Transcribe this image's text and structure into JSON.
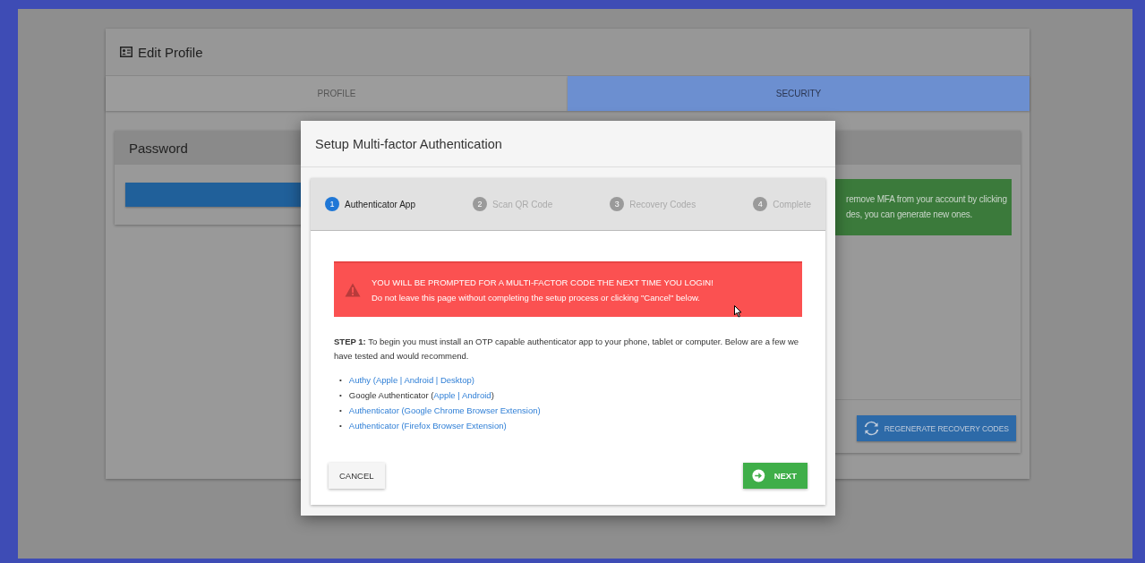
{
  "page": {
    "title": "Edit Profile",
    "tabs": [
      {
        "label": "PROFILE",
        "selected": false
      },
      {
        "label": "SECURITY",
        "selected": true
      }
    ],
    "password_panel": {
      "title": "Password"
    },
    "mfa_notice": {
      "lines": [
        "remove MFA from your account by clicking",
        "des, you can generate new ones."
      ]
    },
    "regenerate_button": "REGENERATE RECOVERY CODES"
  },
  "modal": {
    "title": "Setup Multi-factor Authentication",
    "steps": [
      {
        "number": "1",
        "label": "Authenticator App",
        "selected": true
      },
      {
        "number": "2",
        "label": "Scan QR Code",
        "selected": false
      },
      {
        "number": "3",
        "label": "Recovery Codes",
        "selected": false
      },
      {
        "number": "4",
        "label": "Complete",
        "selected": false
      }
    ],
    "alert": {
      "heading": "YOU WILL BE PROMPTED FOR A MULTI-FACTOR CODE THE NEXT TIME YOU LOGIN!",
      "text": "Do not leave this page without completing the setup process or clicking \"Cancel\" below."
    },
    "instructions": "**STEP 1:** To begin you must install an OTP capable authenticator app to your phone, tablet or computer. Below are a few we have tested and would recommend.",
    "bullet": "•",
    "apps": [
      {
        "parts": [
          {
            "text": "Authy (Apple | Android | Desktop)",
            "link": true
          }
        ]
      },
      {
        "parts": [
          {
            "text": "Google Authenticator (",
            "link": false
          },
          {
            "text": "Apple | Android",
            "link": true
          },
          {
            "text": ")",
            "link": false
          }
        ]
      },
      {
        "parts": [
          {
            "text": "Authenticator (Google Chrome Browser Extension)",
            "link": true
          }
        ]
      },
      {
        "parts": [
          {
            "text": "Authenticator (Firefox Browser Extension)",
            "link": true
          }
        ]
      }
    ],
    "cancel_button": "CANCEL",
    "next_button": "NEXT"
  }
}
